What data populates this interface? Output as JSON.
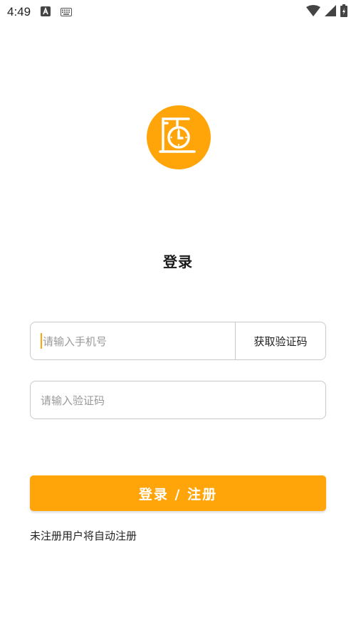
{
  "status_bar": {
    "time": "4:49",
    "icons": [
      "notification-a-icon",
      "keyboard-icon",
      "wifi-icon",
      "signal-icon",
      "battery-icon"
    ]
  },
  "logo": {
    "icon": "clock-sign-icon",
    "color": "#ffa50a"
  },
  "title": "登录",
  "phone": {
    "placeholder": "请输入手机号",
    "value": "",
    "get_code_label": "获取验证码"
  },
  "code": {
    "placeholder": "请输入验证码",
    "value": ""
  },
  "login_button": {
    "label": "登录 / 注册",
    "color": "#ffa50a"
  },
  "hint": "未注册用户将自动注册"
}
